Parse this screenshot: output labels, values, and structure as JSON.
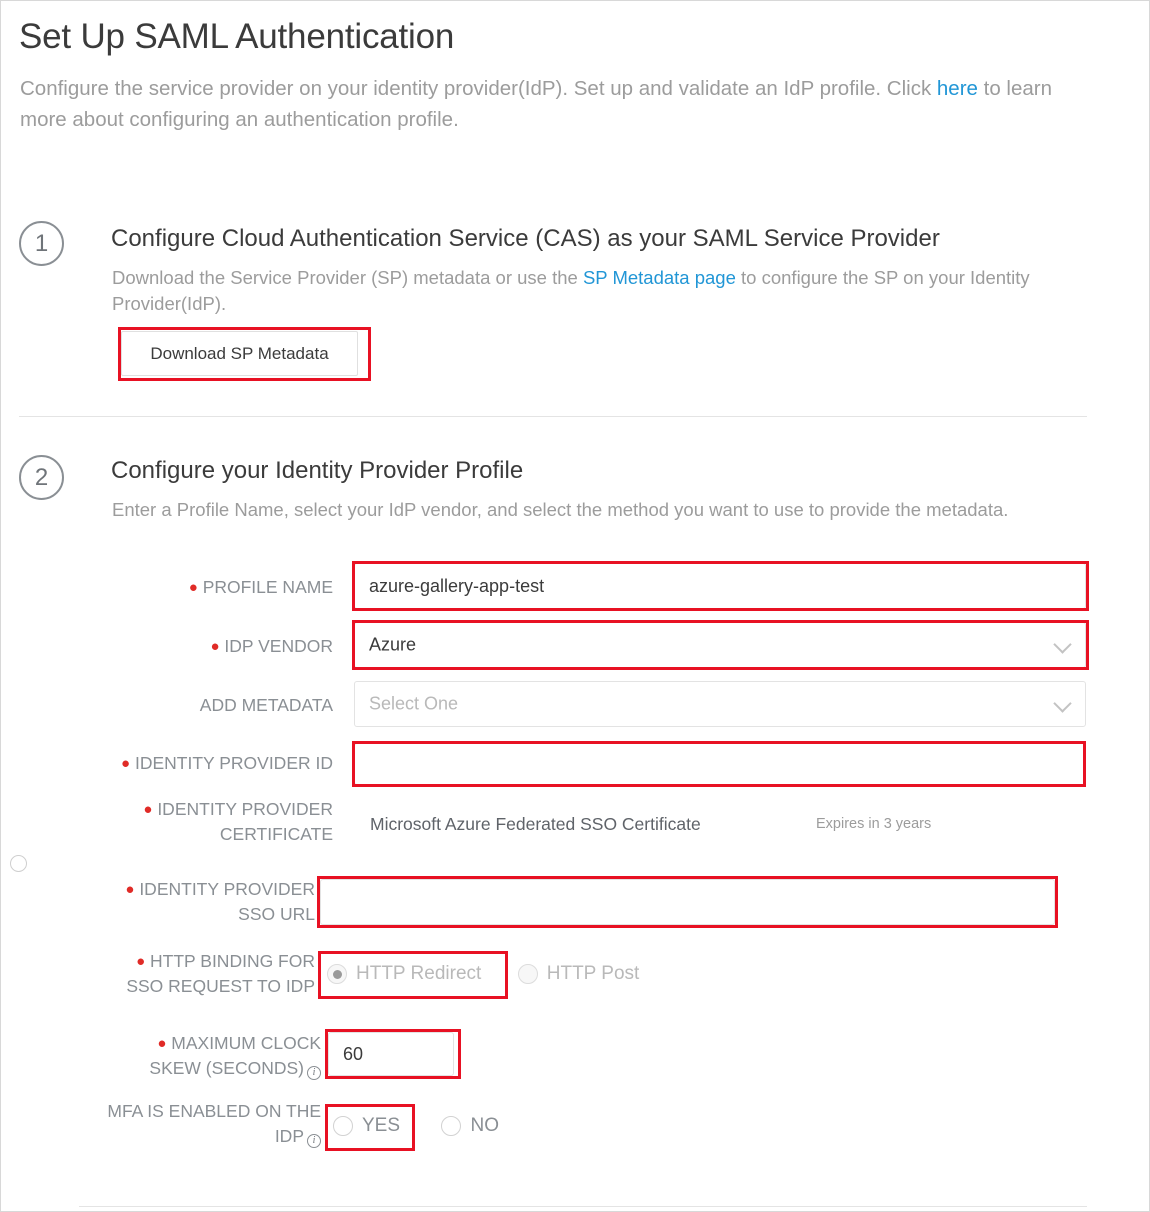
{
  "header": {
    "title": "Set Up SAML Authentication",
    "subtitle_part1": "Configure the service provider on your identity provider(IdP). Set up and validate an IdP profile. Click ",
    "subtitle_link": "here",
    "subtitle_part2": " to learn more about configuring an authentication profile."
  },
  "step1": {
    "number": "1",
    "title": "Configure Cloud Authentication Service (CAS) as your SAML Service Provider",
    "desc_part1": "Download the Service Provider (SP) metadata or use the ",
    "desc_link": "SP Metadata page",
    "desc_part2": " to configure the SP on your Identity Provider(IdP).",
    "download_button": "Download SP Metadata"
  },
  "step2": {
    "number": "2",
    "title": "Configure your Identity Provider Profile",
    "desc": "Enter a Profile Name, select your IdP vendor, and select the method you want to use to provide the metadata.",
    "fields": {
      "profile_name": {
        "label": "PROFILE NAME",
        "value": "azure-gallery-app-test",
        "required": true
      },
      "idp_vendor": {
        "label": "IDP VENDOR",
        "value": "Azure",
        "required": true
      },
      "add_metadata": {
        "label": "ADD METADATA",
        "placeholder": "Select One",
        "required": false
      },
      "identity_provider_id": {
        "label": "IDENTITY PROVIDER ID",
        "value": "",
        "required": true
      },
      "identity_provider_certificate": {
        "label_line1": "IDENTITY PROVIDER",
        "label_line2": "CERTIFICATE",
        "value": "Microsoft Azure Federated SSO Certificate",
        "expiry": "Expires in 3 years",
        "required": true
      },
      "identity_provider_sso_url": {
        "label_line1": "IDENTITY PROVIDER",
        "label_line2": "SSO URL",
        "value": "",
        "required": true
      },
      "http_binding": {
        "label_line1": "HTTP BINDING FOR",
        "label_line2": "SSO REQUEST TO IDP",
        "required": true,
        "options": [
          {
            "label": "HTTP Redirect",
            "selected": true
          },
          {
            "label": "HTTP Post",
            "selected": false
          }
        ]
      },
      "max_clock_skew": {
        "label_line1": "MAXIMUM CLOCK",
        "label_line2": "SKEW (SECONDS)",
        "value": "60",
        "required": true,
        "info_icon": "info-icon"
      },
      "mfa_enabled": {
        "label_line1": "MFA IS ENABLED ON THE",
        "label_line2": "IDP",
        "required": false,
        "info_icon": "info-icon",
        "options": [
          {
            "label": "YES",
            "selected": false
          },
          {
            "label": "NO",
            "selected": false
          }
        ]
      }
    }
  },
  "colors": {
    "highlight": "#e81123",
    "link": "#2196d6",
    "required_dot": "#e02b27",
    "label": "#8a8f94"
  }
}
